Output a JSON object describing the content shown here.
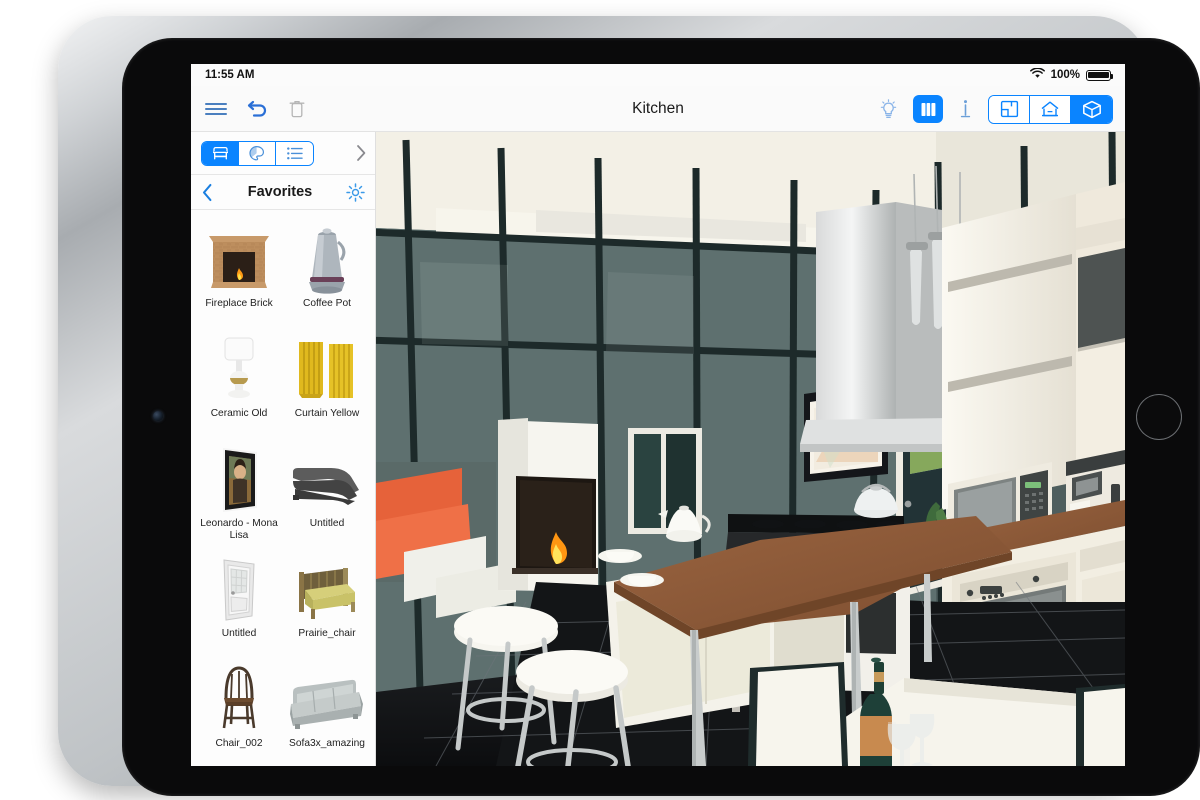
{
  "status_bar": {
    "time": "11:55 AM",
    "wifi_icon": "wifi-icon",
    "battery_percent": "100%",
    "battery_icon": "battery-full-icon"
  },
  "navbar": {
    "menu_icon": "hamburger-menu-icon",
    "undo_icon": "undo-arrow-icon",
    "delete_icon": "trash-icon",
    "title": "Kitchen",
    "light_icon": "lightbulb-icon",
    "library_icon": "library-books-icon",
    "info_icon": "info-icon",
    "view_modes": [
      {
        "name": "floorplan-view",
        "icon": "floorplan-icon",
        "selected": false
      },
      {
        "name": "elevation-view",
        "icon": "house-icon",
        "selected": false
      },
      {
        "name": "3d-view",
        "icon": "cube-3d-icon",
        "selected": true
      }
    ]
  },
  "panel": {
    "categories": [
      {
        "name": "furniture-tab",
        "icon": "armchair-icon",
        "selected": true
      },
      {
        "name": "materials-tab",
        "icon": "color-swatch-icon",
        "selected": false
      },
      {
        "name": "list-tab",
        "icon": "list-icon",
        "selected": false
      }
    ],
    "expand_icon": "chevron-right-icon",
    "back_icon": "chevron-left-icon",
    "title": "Favorites",
    "settings_icon": "settings-gear-icon",
    "items": [
      {
        "label": "Fireplace Brick",
        "icon": "fireplace-thumb"
      },
      {
        "label": "Coffee Pot",
        "icon": "coffeepot-thumb"
      },
      {
        "label": "Ceramic Old",
        "icon": "lamp-thumb"
      },
      {
        "label": "Curtain Yellow",
        "icon": "curtain-thumb"
      },
      {
        "label": "Leonardo - Mona Lisa",
        "icon": "painting-thumb"
      },
      {
        "label": "Untitled",
        "icon": "sectional-sofa-thumb"
      },
      {
        "label": "Untitled",
        "icon": "door-thumb"
      },
      {
        "label": "Prairie_chair",
        "icon": "armchair-thumb"
      },
      {
        "label": "Chair_002",
        "icon": "wood-chair-thumb"
      },
      {
        "label": "Sofa3x_amazing",
        "icon": "grey-sofa-thumb"
      }
    ]
  },
  "viewport": {
    "name": "3d-scene-kitchen",
    "description": "3D rendered kitchen interior"
  },
  "colors": {
    "accent": "#0a84ff",
    "wall": "#5b6d6d",
    "frame_black": "#1e2a2a",
    "counter_brown": "#8a5a3c",
    "floor_black": "#1a1a1a",
    "sofa_orange": "#e8643c",
    "cabinet_white": "#f3efe6"
  }
}
